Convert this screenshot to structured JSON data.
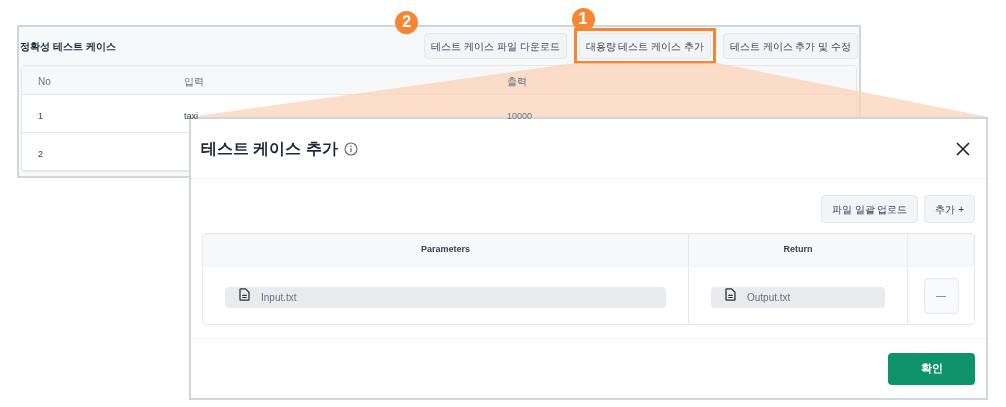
{
  "panel": {
    "title": "정확성 테스트 케이스",
    "buttons": [
      {
        "label": "테스트 케이스 파일 다운로드",
        "highlighted": false,
        "callout": "2"
      },
      {
        "label": "대용량 테스트 케이스 추가",
        "highlighted": true,
        "callout": "1"
      },
      {
        "label": "테스트 케이스 추가 및 수정",
        "highlighted": false
      }
    ],
    "table": {
      "columns": [
        "No",
        "입력",
        "출력"
      ],
      "rows": [
        {
          "cells": [
            "1",
            "taxi",
            "10000"
          ]
        },
        {
          "cells": [
            "2"
          ]
        }
      ]
    }
  },
  "modal": {
    "title": "테스트 케이스 추가",
    "buttons": [
      "파일 일괄 업로드",
      "추가 +"
    ],
    "table": {
      "columns": [
        "Parameters",
        "Return"
      ],
      "rows": [
        {
          "input_placeholder": "Input.txt",
          "output_placeholder": "Output.txt",
          "remove": "—"
        }
      ]
    },
    "confirm": "확인"
  }
}
